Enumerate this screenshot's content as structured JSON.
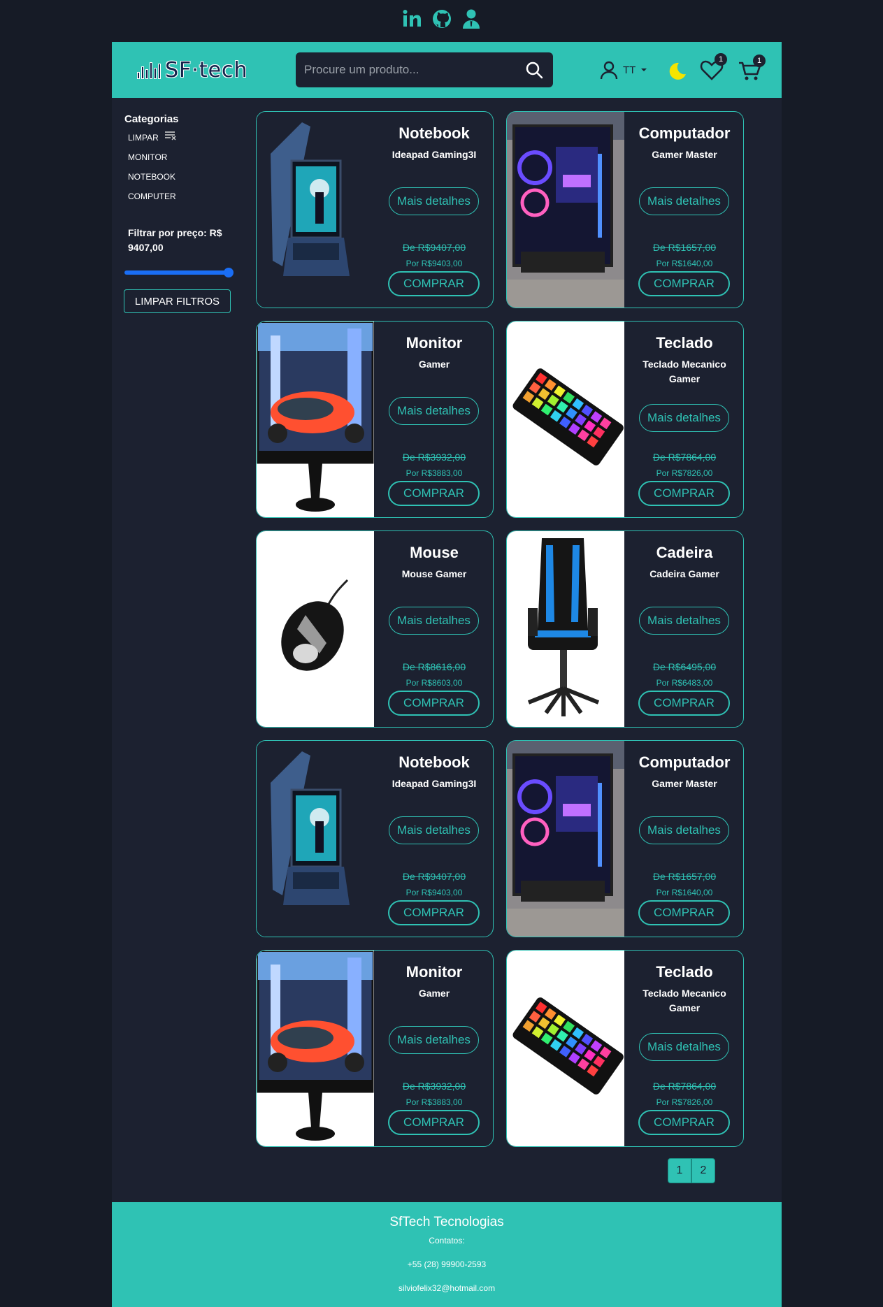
{
  "social": {
    "icons": [
      "linkedin-icon",
      "github-icon",
      "user-tie-icon"
    ]
  },
  "header": {
    "logo_text": "SF·tech",
    "search_placeholder": "Procure um produto...",
    "user_name": "TT",
    "wishlist_count": "1",
    "cart_count": "1",
    "colors": {
      "accent": "#2fc2b4",
      "background": "#161b26",
      "panel": "#1c2130",
      "moon": "#f5e400"
    }
  },
  "sidebar": {
    "title": "Categorias",
    "categories": [
      "LIMPAR",
      "MONITOR",
      "NOTEBOOK",
      "COMPUTER"
    ],
    "filter_label": "Filtrar por preço: R$ 9407,00",
    "slider_value_fraction": 1.0,
    "clear_button": "LIMPAR FILTROS"
  },
  "products": [
    {
      "name": "Notebook",
      "desc": "Ideapad Gaming3I",
      "more": "Mais detalhes",
      "old_price": "De R$9407,00",
      "new_price": "Por R$9403,00",
      "buy": "COMPRAR",
      "image": "notebook"
    },
    {
      "name": "Computador",
      "desc": "Gamer Master",
      "more": "Mais detalhes",
      "old_price": "De R$1657,00",
      "new_price": "Por R$1640,00",
      "buy": "COMPRAR",
      "image": "computer"
    },
    {
      "name": "Monitor",
      "desc": "Gamer",
      "more": "Mais detalhes",
      "old_price": "De R$3932,00",
      "new_price": "Por R$3883,00",
      "buy": "COMPRAR",
      "image": "monitor"
    },
    {
      "name": "Teclado",
      "desc": "Teclado Mecanico Gamer",
      "more": "Mais detalhes",
      "old_price": "De R$7864,00",
      "new_price": "Por R$7826,00",
      "buy": "COMPRAR",
      "image": "keyboard"
    },
    {
      "name": "Mouse",
      "desc": "Mouse Gamer",
      "more": "Mais detalhes",
      "old_price": "De R$8616,00",
      "new_price": "Por R$8603,00",
      "buy": "COMPRAR",
      "image": "mouse"
    },
    {
      "name": "Cadeira",
      "desc": "Cadeira Gamer",
      "more": "Mais detalhes",
      "old_price": "De R$6495,00",
      "new_price": "Por R$6483,00",
      "buy": "COMPRAR",
      "image": "chair"
    },
    {
      "name": "Notebook",
      "desc": "Ideapad Gaming3I",
      "more": "Mais detalhes",
      "old_price": "De R$9407,00",
      "new_price": "Por R$9403,00",
      "buy": "COMPRAR",
      "image": "notebook"
    },
    {
      "name": "Computador",
      "desc": "Gamer Master",
      "more": "Mais detalhes",
      "old_price": "De R$1657,00",
      "new_price": "Por R$1640,00",
      "buy": "COMPRAR",
      "image": "computer"
    },
    {
      "name": "Monitor",
      "desc": "Gamer",
      "more": "Mais detalhes",
      "old_price": "De R$3932,00",
      "new_price": "Por R$3883,00",
      "buy": "COMPRAR",
      "image": "monitor"
    },
    {
      "name": "Teclado",
      "desc": "Teclado Mecanico Gamer",
      "more": "Mais detalhes",
      "old_price": "De R$7864,00",
      "new_price": "Por R$7826,00",
      "buy": "COMPRAR",
      "image": "keyboard"
    }
  ],
  "pagination": {
    "pages": [
      "1",
      "2"
    ]
  },
  "footer": {
    "title": "SfTech Tecnologias",
    "contacts_label": "Contatos:",
    "phone": "+55 (28) 99900-2593",
    "email": "silviofelix32@hotmail.com"
  }
}
